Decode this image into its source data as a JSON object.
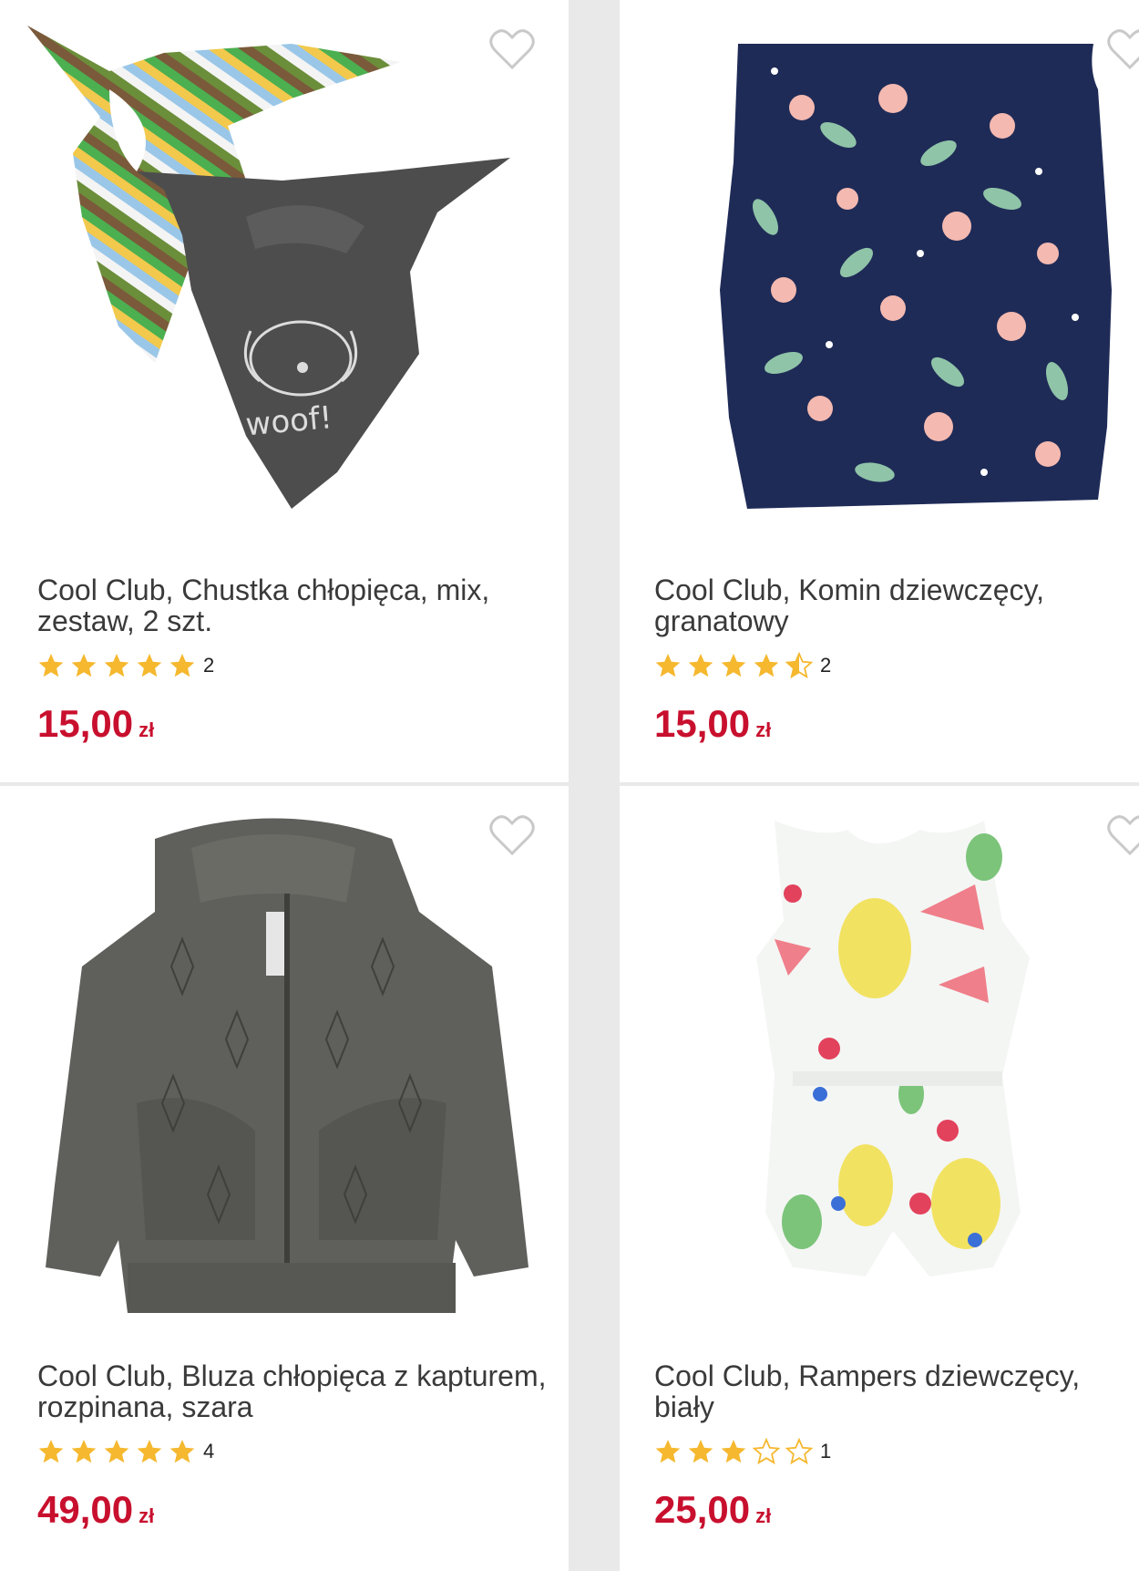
{
  "accent_color": "#c8102e",
  "star_color": "#f5b82e",
  "products": [
    {
      "title": "Cool Club, Chustka chłopięca, mix, zestaw, 2 szt.",
      "rating": 5,
      "review_count": "2",
      "price": "15,00",
      "currency": "zł",
      "image_icon": "bandana-set-image"
    },
    {
      "title": "Cool Club, Komin dziewczęcy, granatowy",
      "rating": 4.5,
      "review_count": "2",
      "price": "15,00",
      "currency": "zł",
      "image_icon": "floral-snood-image"
    },
    {
      "title": "Cool Club, Bluza chłopięca z kapturem, rozpinana, szara",
      "rating": 5,
      "review_count": "4",
      "price": "49,00",
      "currency": "zł",
      "image_icon": "grey-hoodie-image"
    },
    {
      "title": "Cool Club, Rampers dziewczęcy, biały",
      "rating": 3,
      "review_count": "1",
      "price": "25,00",
      "currency": "zł",
      "image_icon": "fruit-romper-image"
    }
  ],
  "image_text": {
    "woof": "woof!"
  }
}
